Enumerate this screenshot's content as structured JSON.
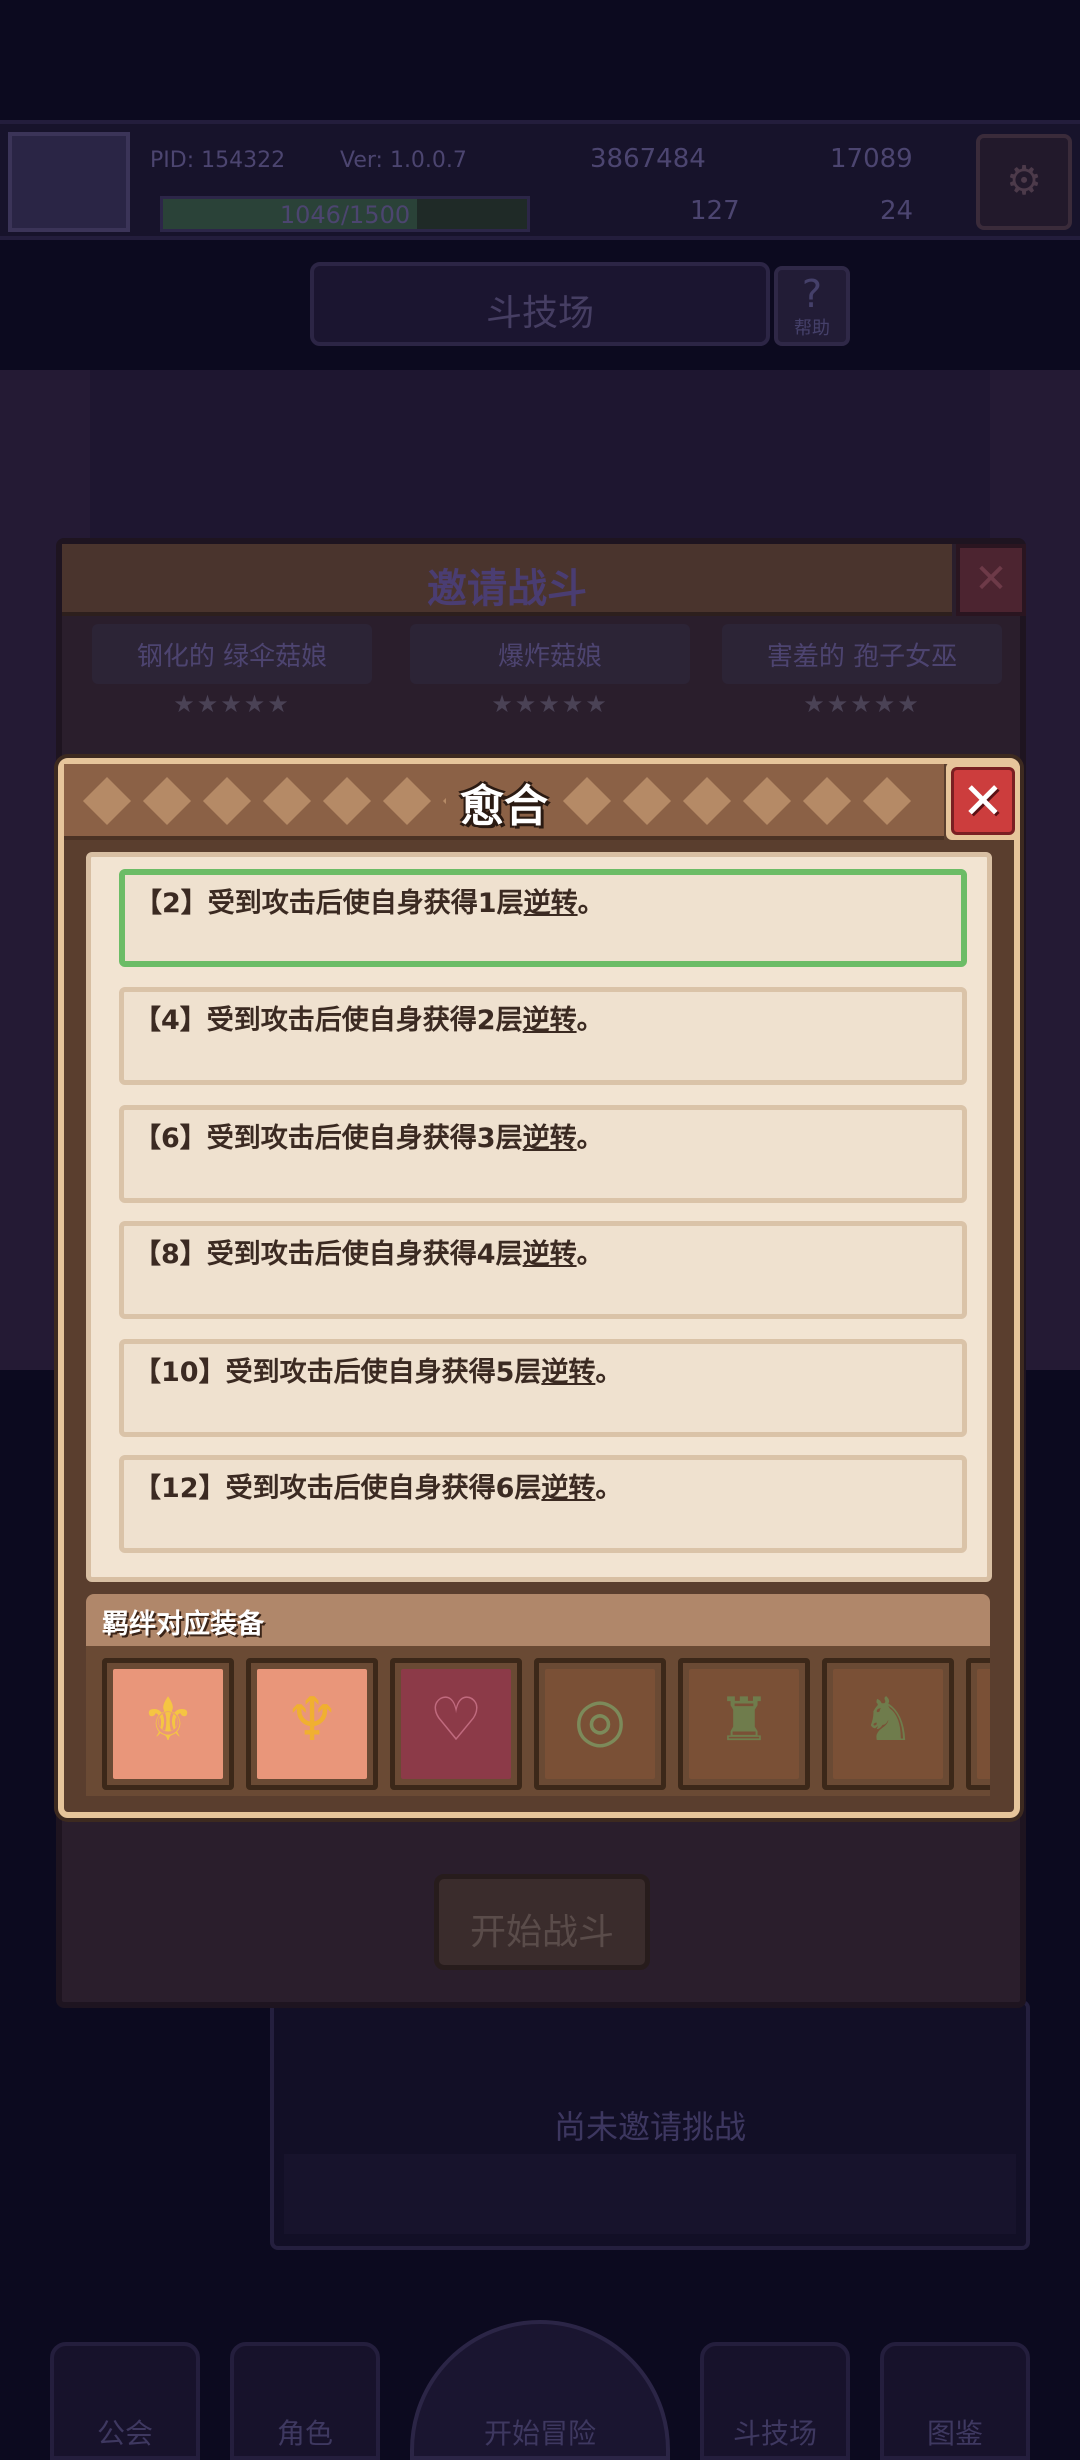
{
  "player": {
    "pid_text": "PID: 154322",
    "version_text": "Ver: 1.0.0.7",
    "coins": "3867484",
    "gems": "17089",
    "clover": "127",
    "keys": "24",
    "xp_text": "1046/1500",
    "xp_progress": 0.697
  },
  "arena": {
    "title": "斗技场",
    "help_label": "帮助",
    "help_q": "?"
  },
  "invite_dialog": {
    "title": "邀请战斗",
    "characters": [
      {
        "name": "钢化的 绿伞菇娘",
        "stars": "★★★★★"
      },
      {
        "name": "爆炸菇娘",
        "stars": "★★★★★"
      },
      {
        "name": "害羞的 孢子女巫",
        "stars": "★★★★★"
      }
    ],
    "start_label": "开始战斗"
  },
  "bond_modal": {
    "title": "愈合",
    "close_glyph": "✕",
    "effects": [
      {
        "tier": "【2】",
        "text": "受到攻击后使自身获得1层",
        "keyword": "逆转",
        "end": "。",
        "active": true
      },
      {
        "tier": "【4】",
        "text": "受到攻击后使自身获得2层",
        "keyword": "逆转",
        "end": "。",
        "active": false
      },
      {
        "tier": "【6】",
        "text": "受到攻击后使自身获得3层",
        "keyword": "逆转",
        "end": "。",
        "active": false
      },
      {
        "tier": "【8】",
        "text": "受到攻击后使自身获得4层",
        "keyword": "逆转",
        "end": "。",
        "active": false
      },
      {
        "tier": "【10】",
        "text": "受到攻击后使自身获得5层",
        "keyword": "逆转",
        "end": "。",
        "active": false
      },
      {
        "tier": "【12】",
        "text": "受到攻击后使自身获得6层",
        "keyword": "逆转",
        "end": "。",
        "active": false
      }
    ],
    "equipment_label": "羁绊对应装备",
    "equipment": [
      {
        "icon": "crown-shield-icon",
        "glyph": "⚜",
        "bg": "#e9967a",
        "fg": "#f5c542"
      },
      {
        "icon": "horned-helmet-icon",
        "glyph": "♆",
        "bg": "#e9967a",
        "fg": "#f0b030"
      },
      {
        "icon": "chest-armor-icon",
        "glyph": "♡",
        "bg": "#8c3a48",
        "fg": "#c06a7e"
      },
      {
        "icon": "bracelet-icon",
        "glyph": "◎",
        "bg": "#7a5036",
        "fg": "#7c8a5a"
      },
      {
        "icon": "spiked-armor-icon",
        "glyph": "♜",
        "bg": "#7a5036",
        "fg": "#6f7c4c"
      },
      {
        "icon": "horned-mask-icon",
        "glyph": "♞",
        "bg": "#7a5036",
        "fg": "#6f7c4c"
      }
    ]
  },
  "invite_panel": {
    "empty_text": "尚未邀请挑战"
  },
  "bottom_nav": {
    "guild": "公会",
    "character": "角色",
    "adventure": "开始冒险",
    "arena": "斗技场",
    "codex": "图鉴"
  }
}
